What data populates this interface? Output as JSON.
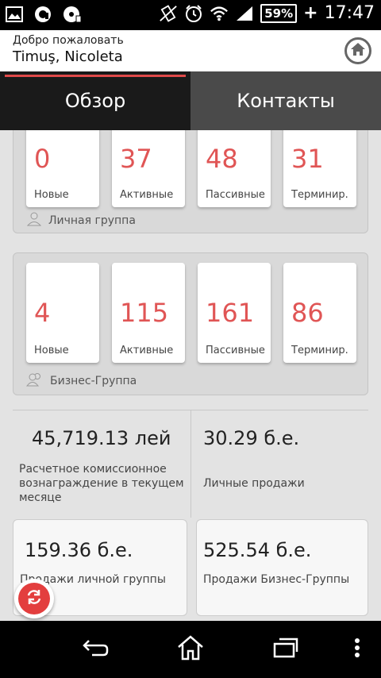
{
  "status_bar": {
    "battery": "59%",
    "charging": "+",
    "time": "17:47"
  },
  "header": {
    "welcome": "Добро пожаловать",
    "user_name": "Timuş, Nicoleta"
  },
  "tabs": [
    {
      "label": "Обзор",
      "active": true
    },
    {
      "label": "Контакты",
      "active": false
    }
  ],
  "personal_group": {
    "label": "Личная группа",
    "cards": [
      {
        "value": "0",
        "label": "Новые"
      },
      {
        "value": "37",
        "label": "Активные"
      },
      {
        "value": "48",
        "label": "Пассивные"
      },
      {
        "value": "31",
        "label": "Терминир."
      }
    ]
  },
  "business_group": {
    "label": "Бизнес-Группа",
    "cards": [
      {
        "value": "4",
        "label": "Новые"
      },
      {
        "value": "115",
        "label": "Активные"
      },
      {
        "value": "161",
        "label": "Пассивные"
      },
      {
        "value": "86",
        "label": "Терминир."
      }
    ]
  },
  "stats": [
    {
      "value": "45,719.13 лей",
      "label": "Расчетное комиссионное вознаграждение в текущем месяце"
    },
    {
      "value": "30.29 б.е.",
      "label": "Личные продажи"
    },
    {
      "value": "159.36 б.е.",
      "label": "Продажи личной группы"
    },
    {
      "value": "525.54 б.е.",
      "label": "Продажи Бизнес-Группы"
    }
  ],
  "colors": {
    "accent": "#e05555",
    "tab_indicator": "#e04a4a",
    "refresh_button": "#e33e3e"
  }
}
